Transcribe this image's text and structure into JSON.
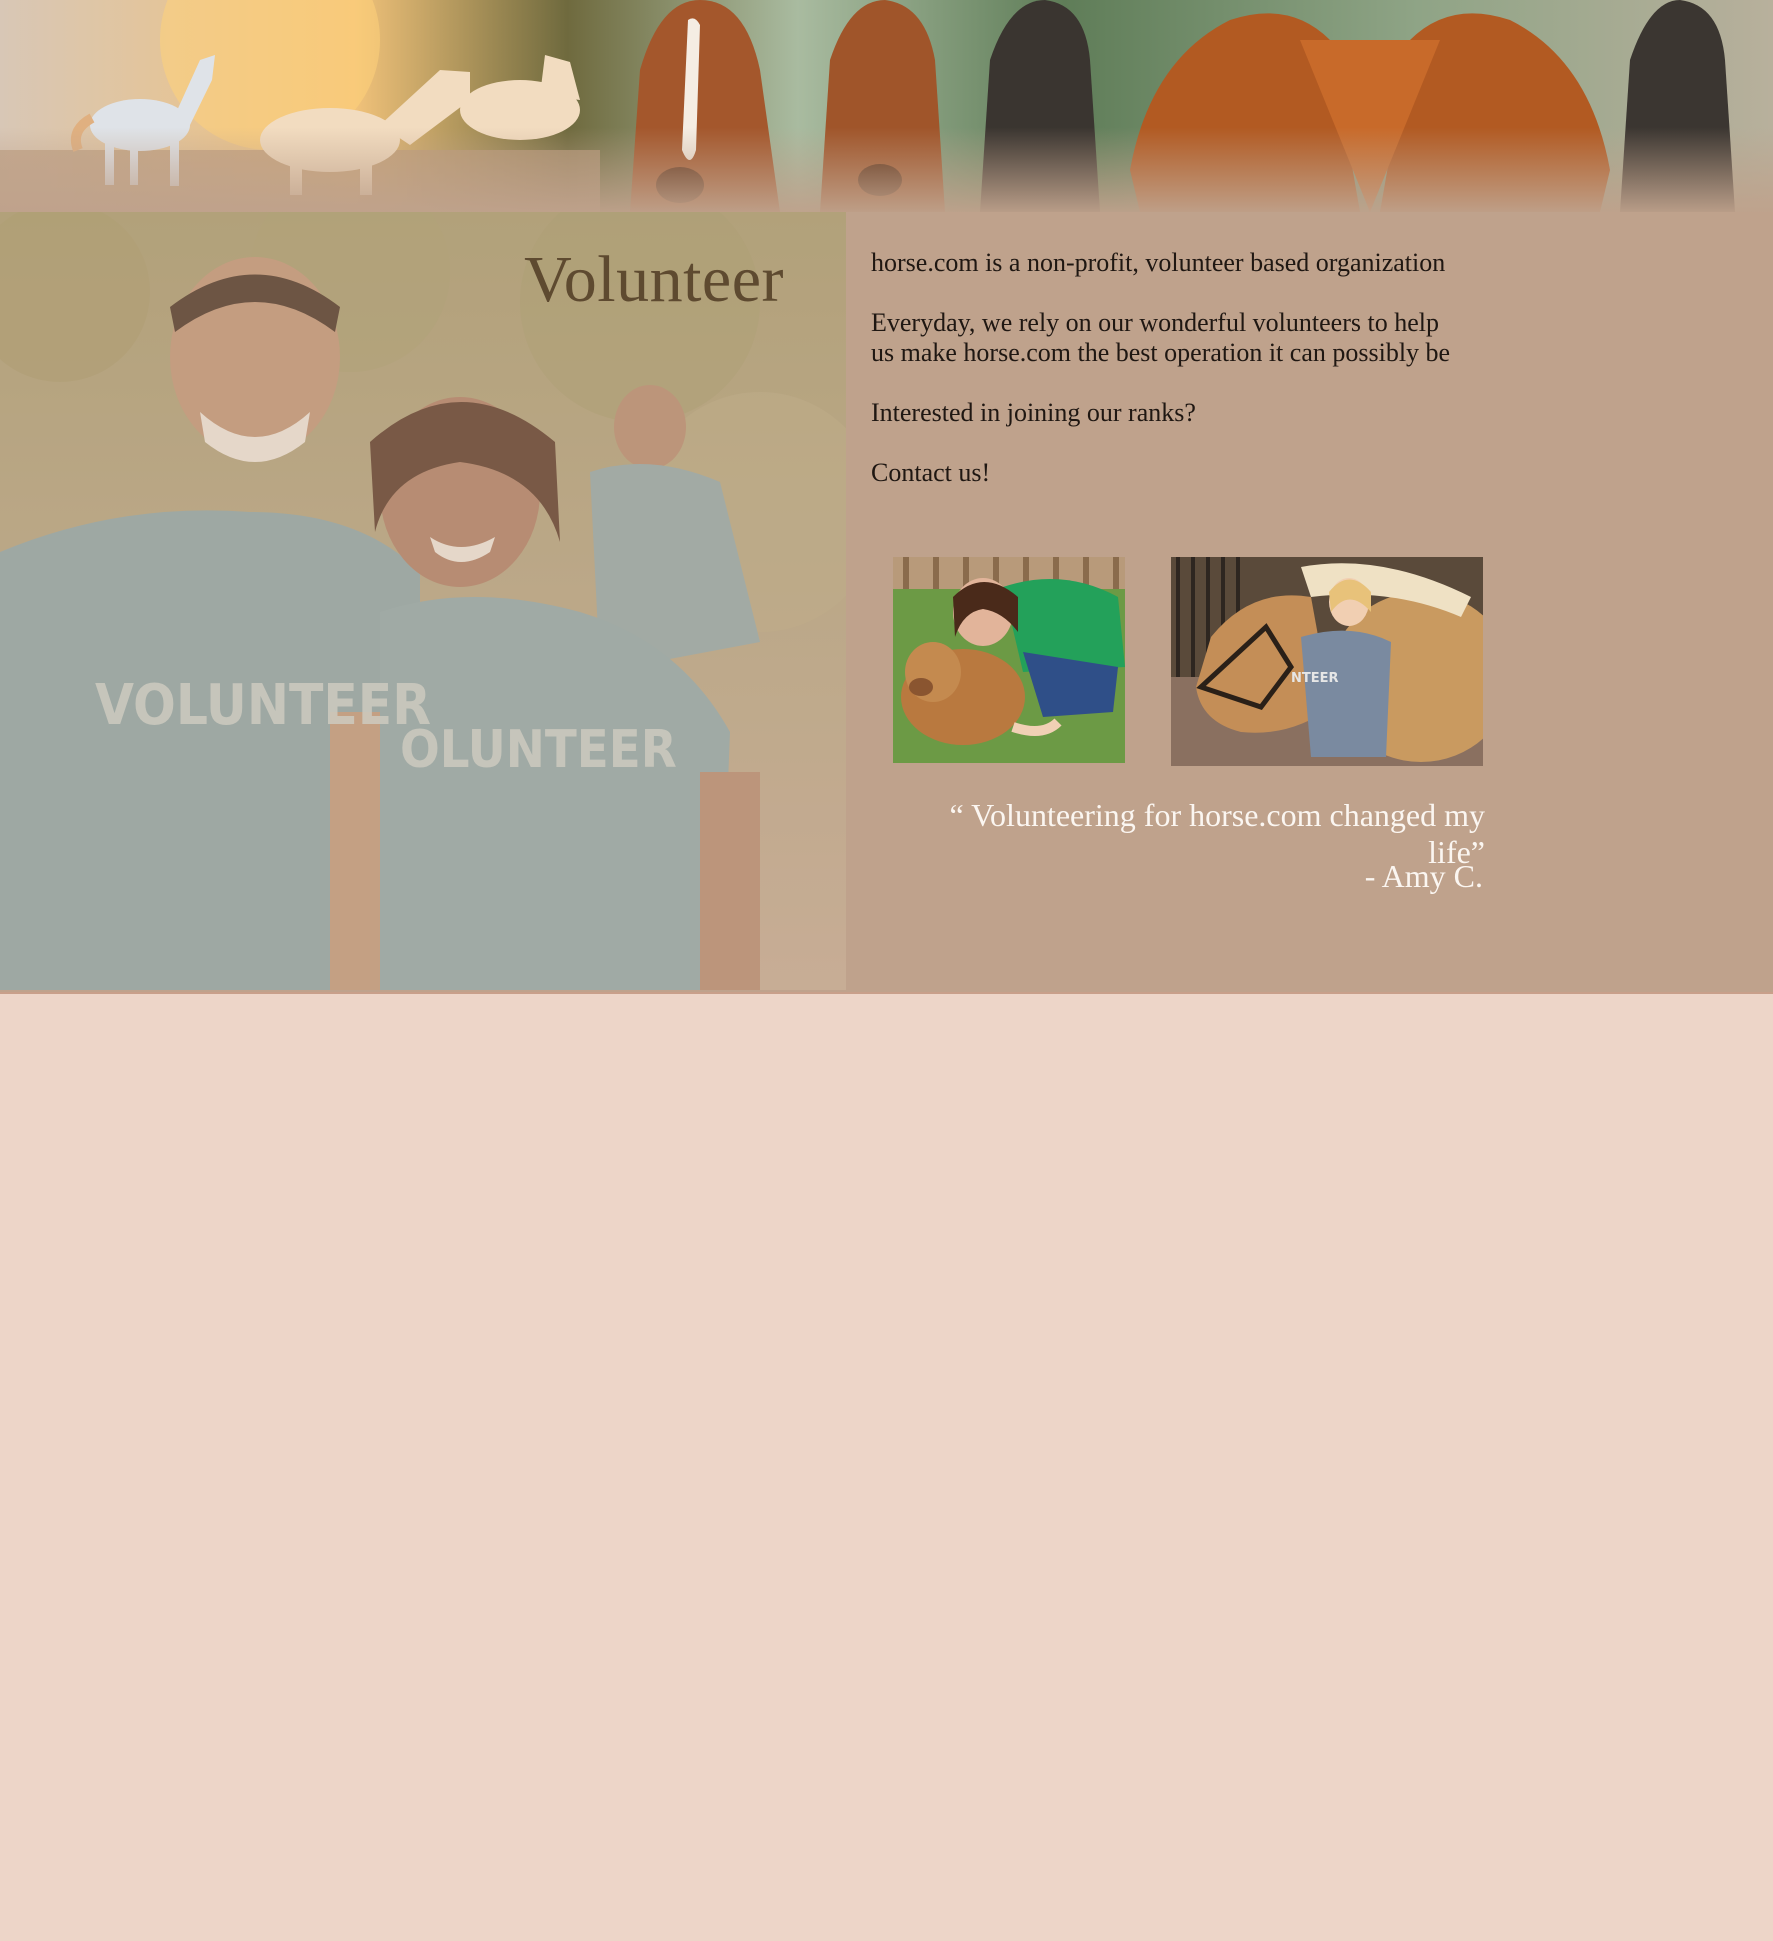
{
  "banner": {
    "image_alt": "horses banner"
  },
  "hero": {
    "title": "Volunteer",
    "shirt_text_left": "VOLUNTEER",
    "shirt_text_right": "OLUNTEER"
  },
  "info": {
    "line1": "horse.com is a non-profit, volunteer based organization",
    "line2a": "Everyday, we rely on our wonderful volunteers to help",
    "line2b": "us make horse.com the best operation it can possibly be",
    "line3": "Interested in joining our ranks?",
    "line4": "Contact us!"
  },
  "thumbs": {
    "horse_shirt_text": "NTEER"
  },
  "testimonial": {
    "quote": "“ Volunteering for horse.com changed my life”",
    "author": "- Amy C."
  },
  "colors": {
    "page_bg": "#edd5c8",
    "band_bg": "#bfa28c",
    "title": "#5e4a30",
    "quote": "#fbf6f1"
  }
}
